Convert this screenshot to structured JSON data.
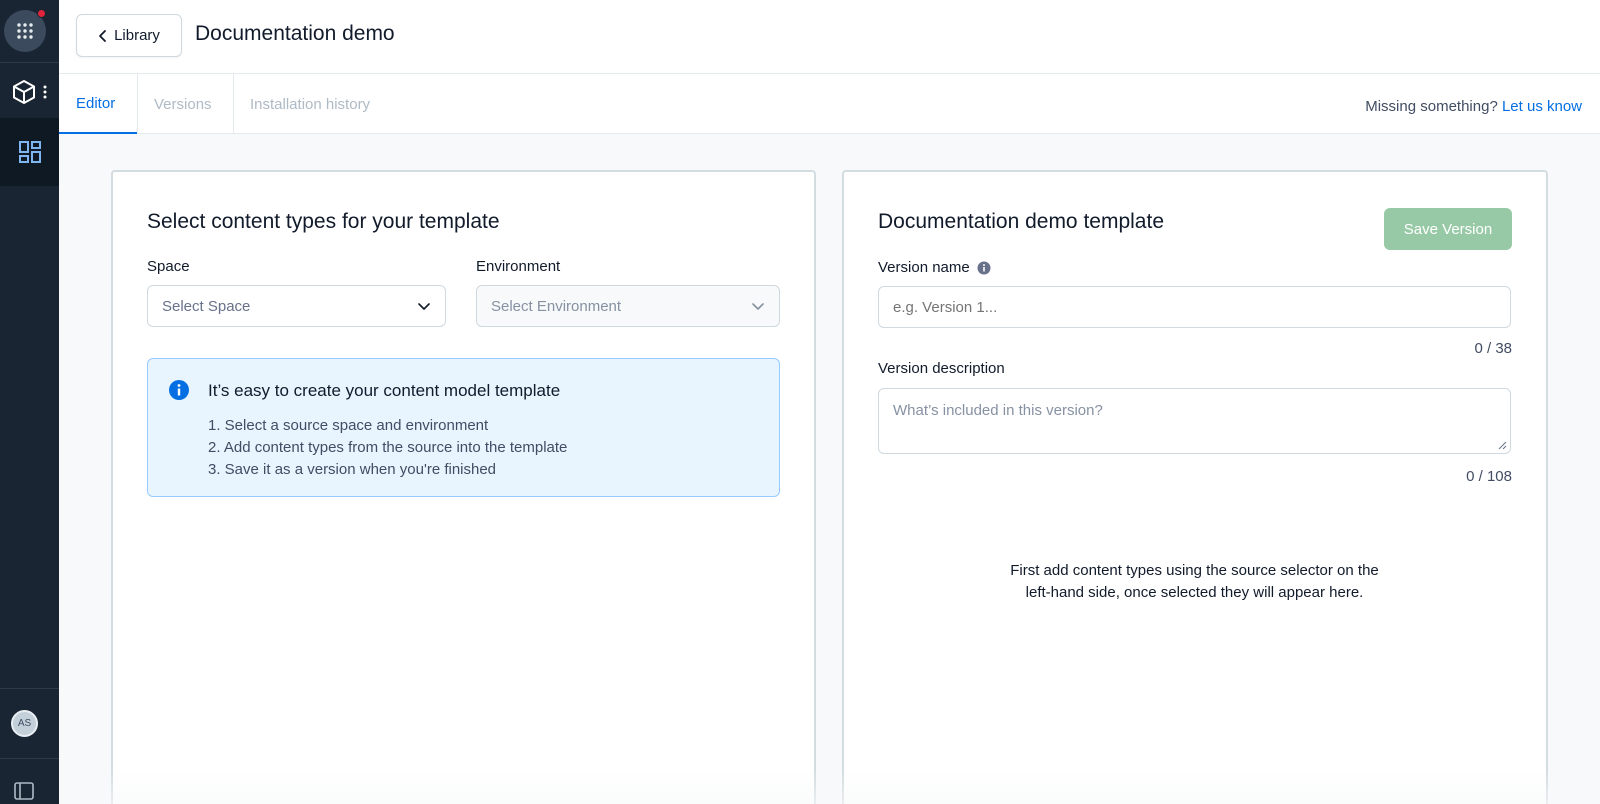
{
  "sidebar": {
    "apps_icon": "grid-dots-icon",
    "app_icon": "cube-icon",
    "more_icon": "kebab-icon",
    "dashboard_icon": "dashboard-icon",
    "avatar_initials": "AS",
    "panel_icon": "sidebar-toggle-icon",
    "notification_color": "#e1243c"
  },
  "header": {
    "back_label": "Library",
    "title": "Documentation demo"
  },
  "tabs": [
    {
      "label": "Editor",
      "active": true
    },
    {
      "label": "Versions",
      "active": false
    },
    {
      "label": "Installation history",
      "active": false
    }
  ],
  "feedback": {
    "prompt": "Missing something?",
    "link": "Let us know"
  },
  "left_panel": {
    "title": "Select content types for your template",
    "space_label": "Space",
    "space_placeholder": "Select Space",
    "environment_label": "Environment",
    "environment_placeholder": "Select Environment",
    "note": {
      "title": "It’s easy to create your content model template",
      "steps": [
        "1. Select a source space and environment",
        "2. Add content types from the source into the template",
        "3. Save it as a version when you're finished"
      ]
    }
  },
  "right_panel": {
    "title": "Documentation demo template",
    "save_label": "Save Version",
    "version_name_label": "Version name",
    "version_name_placeholder": "e.g. Version 1...",
    "version_name_counter": "0 / 38",
    "version_desc_label": "Version description",
    "version_desc_placeholder": "What’s included in this version?",
    "version_desc_counter": "0 / 108",
    "empty_line1": "First add content types using the source selector on the",
    "empty_line2": "left-hand side, once selected they will appear here."
  },
  "colors": {
    "accent": "#036fe3",
    "sidebar": "#192532",
    "save_disabled": "#98c9a6",
    "note_bg": "#e8f5ff"
  }
}
